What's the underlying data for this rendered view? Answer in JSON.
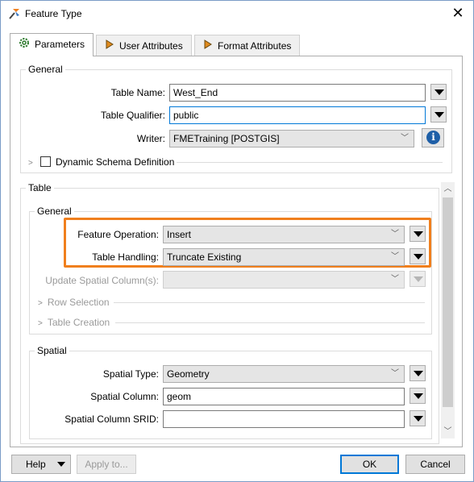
{
  "window": {
    "title": "Feature Type",
    "icon": "fme-icon",
    "close": "✕"
  },
  "tabs": [
    {
      "label": "Parameters",
      "icon": "gear-icon",
      "active": true
    },
    {
      "label": "User Attributes",
      "icon": "arrow-right-icon",
      "active": false
    },
    {
      "label": "Format Attributes",
      "icon": "arrow-right-icon",
      "active": false
    }
  ],
  "general": {
    "group_label": "General",
    "table_name_label": "Table Name:",
    "table_name_value": "West_End",
    "table_qualifier_label": "Table Qualifier:",
    "table_qualifier_value": "public",
    "writer_label": "Writer:",
    "writer_value": "FMETraining [POSTGIS]",
    "dynamic_schema_label": "Dynamic Schema Definition"
  },
  "table": {
    "group_label": "Table",
    "general_group_label": "General",
    "feature_operation_label": "Feature Operation:",
    "feature_operation_value": "Insert",
    "table_handling_label": "Table Handling:",
    "table_handling_value": "Truncate Existing",
    "update_spatial_label": "Update Spatial Column(s):",
    "update_spatial_value": "",
    "row_selection_label": "Row Selection",
    "table_creation_label": "Table Creation"
  },
  "spatial": {
    "group_label": "Spatial",
    "spatial_type_label": "Spatial Type:",
    "spatial_type_value": "Geometry",
    "spatial_column_label": "Spatial Column:",
    "spatial_column_value": "geom",
    "srid_label": "Spatial Column SRID:",
    "srid_value": ""
  },
  "footer": {
    "help_label": "Help",
    "apply_label": "Apply to...",
    "ok_label": "OK",
    "cancel_label": "Cancel"
  },
  "colors": {
    "highlight": "#f07f1d",
    "focus": "#0078d7",
    "info": "#1e5fa7"
  }
}
